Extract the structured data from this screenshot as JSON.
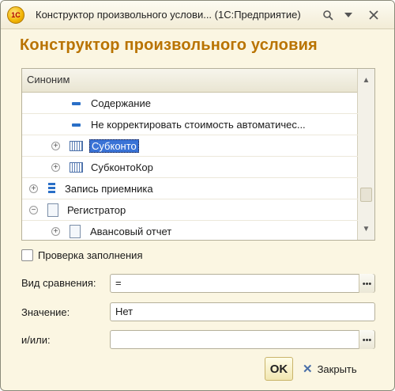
{
  "window": {
    "title": "Конструктор произвольного услови... (1С:Предприятие)",
    "app_icon_label": "1С"
  },
  "heading": "Конструктор произвольного условия",
  "tree": {
    "column_header": "Синоним",
    "rows": [
      {
        "label": "Содержание",
        "icon": "dash-icon",
        "expander": "",
        "selected": false
      },
      {
        "label": "Не корректировать стоимость автоматичес...",
        "icon": "dash-icon",
        "expander": "",
        "selected": false
      },
      {
        "label": "Субконто",
        "icon": "table-icon",
        "expander": "+",
        "selected": true
      },
      {
        "label": "СубконтоКор",
        "icon": "table-icon",
        "expander": "+",
        "selected": false
      },
      {
        "label": "Запись приемника",
        "icon": "stack-icon",
        "expander": "+",
        "selected": false
      },
      {
        "label": "Регистратор",
        "icon": "document-icon",
        "expander": "−",
        "selected": false
      },
      {
        "label": "Авансовый отчет",
        "icon": "document-icon",
        "expander": "+",
        "selected": false
      }
    ]
  },
  "form": {
    "check_fill_label": "Проверка заполнения",
    "check_fill_checked": false,
    "comparison_label": "Вид сравнения:",
    "comparison_value": "=",
    "value_label": "Значение:",
    "value_value": "Нет",
    "andor_label": "и/или:",
    "andor_value": ""
  },
  "buttons": {
    "ok": "OK",
    "close": "Закрыть"
  }
}
